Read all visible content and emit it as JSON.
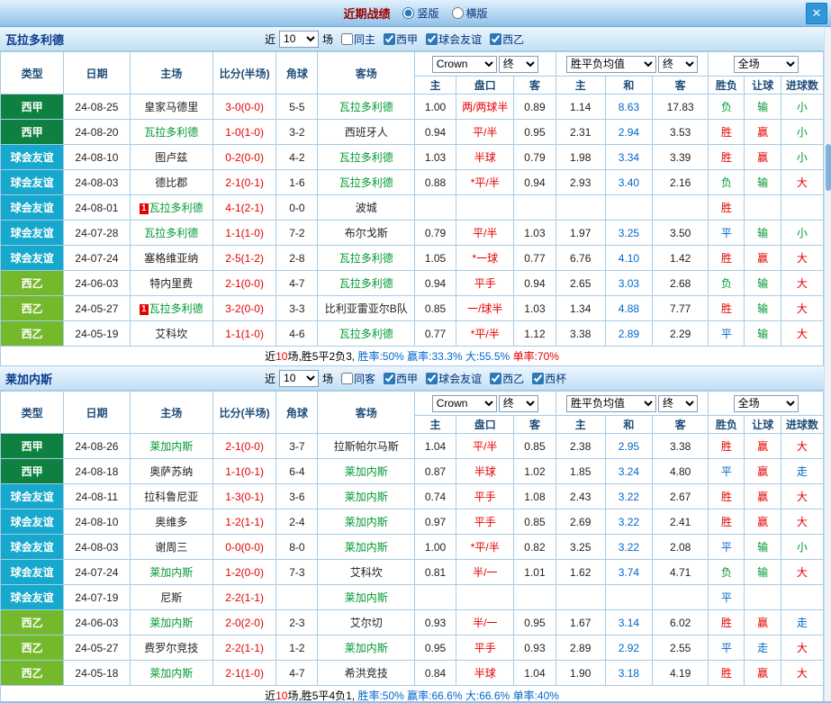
{
  "titlebar": {
    "title": "近期战绩",
    "radios": [
      {
        "label": "竖版",
        "selected": true
      },
      {
        "label": "横版",
        "selected": false
      }
    ],
    "close_glyph": "✕"
  },
  "league_colors": {
    "西甲": "#0e8040",
    "球会友谊": "#17a8cd",
    "西乙": "#74b82c"
  },
  "header": {
    "cols": [
      "类型",
      "日期",
      "主场",
      "比分(半场)",
      "角球",
      "客场"
    ],
    "odds_company": "Crown",
    "final_label": "终",
    "avg_label": "胜平负均值",
    "full_label": "全场",
    "odds_sub": [
      "主",
      "盘口",
      "客"
    ],
    "avg_sub": [
      "主",
      "和",
      "客"
    ],
    "result_sub": [
      "胜负",
      "让球",
      "进球数"
    ]
  },
  "sections": [
    {
      "team": "瓦拉多利德",
      "filter": {
        "prefix": "近",
        "count": "10",
        "suffix": "场",
        "venue_label": "同主",
        "venue_checked": false,
        "leagues": [
          {
            "label": "西甲",
            "checked": true
          },
          {
            "label": "球会友谊",
            "checked": true
          },
          {
            "label": "西乙",
            "checked": true
          }
        ]
      },
      "rows": [
        {
          "league": "西甲",
          "date": "24-08-25",
          "home": "皇家马德里",
          "home_green": false,
          "home_badge": "",
          "score": "3-0(0-0)",
          "corners": "5-5",
          "away": "瓦拉多利德",
          "away_green": true,
          "odds_home": "1.00",
          "handicap": "两/两球半",
          "odds_away": "0.89",
          "avg_home": "1.14",
          "avg_draw": "8.63",
          "avg_away": "17.83",
          "result": "负",
          "result_type": "lose",
          "handicap_result": "输",
          "handicap_type": "lose",
          "goals": "小",
          "goals_type": "lose"
        },
        {
          "league": "西甲",
          "date": "24-08-20",
          "home": "瓦拉多利德",
          "home_green": true,
          "home_badge": "",
          "score": "1-0(1-0)",
          "corners": "3-2",
          "away": "西班牙人",
          "away_green": false,
          "odds_home": "0.94",
          "handicap": "平/半",
          "odds_away": "0.95",
          "avg_home": "2.31",
          "avg_draw": "2.94",
          "avg_away": "3.53",
          "result": "胜",
          "result_type": "win",
          "handicap_result": "赢",
          "handicap_type": "win",
          "goals": "小",
          "goals_type": "lose"
        },
        {
          "league": "球会友谊",
          "date": "24-08-10",
          "home": "图卢兹",
          "home_green": false,
          "home_badge": "",
          "score": "0-2(0-0)",
          "corners": "4-2",
          "away": "瓦拉多利德",
          "away_green": true,
          "odds_home": "1.03",
          "handicap": "半球",
          "odds_away": "0.79",
          "avg_home": "1.98",
          "avg_draw": "3.34",
          "avg_away": "3.39",
          "result": "胜",
          "result_type": "win",
          "handicap_result": "赢",
          "handicap_type": "win",
          "goals": "小",
          "goals_type": "lose"
        },
        {
          "league": "球会友谊",
          "date": "24-08-03",
          "home": "德比郡",
          "home_green": false,
          "home_badge": "",
          "score": "2-1(0-1)",
          "corners": "1-6",
          "away": "瓦拉多利德",
          "away_green": true,
          "odds_home": "0.88",
          "handicap": "*平/半",
          "odds_away": "0.94",
          "avg_home": "2.93",
          "avg_draw": "3.40",
          "avg_away": "2.16",
          "result": "负",
          "result_type": "lose",
          "handicap_result": "输",
          "handicap_type": "lose",
          "goals": "大",
          "goals_type": "win"
        },
        {
          "league": "球会友谊",
          "date": "24-08-01",
          "home": "瓦拉多利德",
          "home_green": true,
          "home_badge": "1",
          "score": "4-1(2-1)",
          "corners": "0-0",
          "away": "波城",
          "away_green": false,
          "odds_home": "",
          "handicap": "",
          "odds_away": "",
          "avg_home": "",
          "avg_draw": "",
          "avg_away": "",
          "result": "胜",
          "result_type": "win",
          "handicap_result": "",
          "handicap_type": "",
          "goals": "",
          "goals_type": ""
        },
        {
          "league": "球会友谊",
          "date": "24-07-28",
          "home": "瓦拉多利德",
          "home_green": true,
          "home_badge": "",
          "score": "1-1(1-0)",
          "corners": "7-2",
          "away": "布尔戈斯",
          "away_green": false,
          "odds_home": "0.79",
          "handicap": "平/半",
          "odds_away": "1.03",
          "avg_home": "1.97",
          "avg_draw": "3.25",
          "avg_away": "3.50",
          "result": "平",
          "result_type": "draw",
          "handicap_result": "输",
          "handicap_type": "lose",
          "goals": "小",
          "goals_type": "lose"
        },
        {
          "league": "球会友谊",
          "date": "24-07-24",
          "home": "塞格维亚纳",
          "home_green": false,
          "home_badge": "",
          "score": "2-5(1-2)",
          "corners": "2-8",
          "away": "瓦拉多利德",
          "away_green": true,
          "odds_home": "1.05",
          "handicap": "*一球",
          "odds_away": "0.77",
          "avg_home": "6.76",
          "avg_draw": "4.10",
          "avg_away": "1.42",
          "result": "胜",
          "result_type": "win",
          "handicap_result": "赢",
          "handicap_type": "win",
          "goals": "大",
          "goals_type": "win"
        },
        {
          "league": "西乙",
          "date": "24-06-03",
          "home": "特内里费",
          "home_green": false,
          "home_badge": "",
          "score": "2-1(0-0)",
          "corners": "4-7",
          "away": "瓦拉多利德",
          "away_green": true,
          "odds_home": "0.94",
          "handicap": "平手",
          "odds_away": "0.94",
          "avg_home": "2.65",
          "avg_draw": "3.03",
          "avg_away": "2.68",
          "result": "负",
          "result_type": "lose",
          "handicap_result": "输",
          "handicap_type": "lose",
          "goals": "大",
          "goals_type": "win"
        },
        {
          "league": "西乙",
          "date": "24-05-27",
          "home": "瓦拉多利德",
          "home_green": true,
          "home_badge": "1",
          "score": "3-2(0-0)",
          "corners": "3-3",
          "away": "比利亚雷亚尔B队",
          "away_green": false,
          "odds_home": "0.85",
          "handicap": "一/球半",
          "odds_away": "1.03",
          "avg_home": "1.34",
          "avg_draw": "4.88",
          "avg_away": "7.77",
          "result": "胜",
          "result_type": "win",
          "handicap_result": "输",
          "handicap_type": "lose",
          "goals": "大",
          "goals_type": "win"
        },
        {
          "league": "西乙",
          "date": "24-05-19",
          "home": "艾科坎",
          "home_green": false,
          "home_badge": "",
          "score": "1-1(1-0)",
          "corners": "4-6",
          "away": "瓦拉多利德",
          "away_green": true,
          "odds_home": "0.77",
          "handicap": "*平/半",
          "odds_away": "1.12",
          "avg_home": "3.38",
          "avg_draw": "2.89",
          "avg_away": "2.29",
          "result": "平",
          "result_type": "draw",
          "handicap_result": "输",
          "handicap_type": "lose",
          "goals": "大",
          "goals_type": "win"
        }
      ],
      "footer_parts": [
        {
          "text": "近",
          "color": "#000000"
        },
        {
          "text": "10",
          "color": "#e60000"
        },
        {
          "text": "场,胜5平2负3, ",
          "color": "#000000"
        },
        {
          "text": "胜率:50%",
          "color": "#0066cc"
        },
        {
          "text": " 赢率:33.3%",
          "color": "#0066cc"
        },
        {
          "text": " 大:55.5%",
          "color": "#0066cc"
        },
        {
          "text": " 单率:70%",
          "color": "#e60000"
        }
      ]
    },
    {
      "team": "莱加内斯",
      "filter": {
        "prefix": "近",
        "count": "10",
        "suffix": "场",
        "venue_label": "同客",
        "venue_checked": false,
        "leagues": [
          {
            "label": "西甲",
            "checked": true
          },
          {
            "label": "球会友谊",
            "checked": true
          },
          {
            "label": "西乙",
            "checked": true
          },
          {
            "label": "西杯",
            "checked": true
          }
        ]
      },
      "rows": [
        {
          "league": "西甲",
          "date": "24-08-26",
          "home": "莱加内斯",
          "home_green": true,
          "home_badge": "",
          "score": "2-1(0-0)",
          "corners": "3-7",
          "away": "拉斯帕尔马斯",
          "away_green": false,
          "odds_home": "1.04",
          "handicap": "平/半",
          "odds_away": "0.85",
          "avg_home": "2.38",
          "avg_draw": "2.95",
          "avg_away": "3.38",
          "result": "胜",
          "result_type": "win",
          "handicap_result": "赢",
          "handicap_type": "win",
          "goals": "大",
          "goals_type": "win"
        },
        {
          "league": "西甲",
          "date": "24-08-18",
          "home": "奥萨苏纳",
          "home_green": false,
          "home_badge": "",
          "score": "1-1(0-1)",
          "corners": "6-4",
          "away": "莱加内斯",
          "away_green": true,
          "odds_home": "0.87",
          "handicap": "半球",
          "odds_away": "1.02",
          "avg_home": "1.85",
          "avg_draw": "3.24",
          "avg_away": "4.80",
          "result": "平",
          "result_type": "draw",
          "handicap_result": "赢",
          "handicap_type": "win",
          "goals": "走",
          "goals_type": "draw"
        },
        {
          "league": "球会友谊",
          "date": "24-08-11",
          "home": "拉科鲁尼亚",
          "home_green": false,
          "home_badge": "",
          "score": "1-3(0-1)",
          "corners": "3-6",
          "away": "莱加内斯",
          "away_green": true,
          "odds_home": "0.74",
          "handicap": "平手",
          "odds_away": "1.08",
          "avg_home": "2.43",
          "avg_draw": "3.22",
          "avg_away": "2.67",
          "result": "胜",
          "result_type": "win",
          "handicap_result": "赢",
          "handicap_type": "win",
          "goals": "大",
          "goals_type": "win"
        },
        {
          "league": "球会友谊",
          "date": "24-08-10",
          "home": "奥维多",
          "home_green": false,
          "home_badge": "",
          "score": "1-2(1-1)",
          "corners": "2-4",
          "away": "莱加内斯",
          "away_green": true,
          "odds_home": "0.97",
          "handicap": "平手",
          "odds_away": "0.85",
          "avg_home": "2.69",
          "avg_draw": "3.22",
          "avg_away": "2.41",
          "result": "胜",
          "result_type": "win",
          "handicap_result": "赢",
          "handicap_type": "win",
          "goals": "大",
          "goals_type": "win"
        },
        {
          "league": "球会友谊",
          "date": "24-08-03",
          "home": "谢周三",
          "home_green": false,
          "home_badge": "",
          "score": "0-0(0-0)",
          "corners": "8-0",
          "away": "莱加内斯",
          "away_green": true,
          "odds_home": "1.00",
          "handicap": "*平/半",
          "odds_away": "0.82",
          "avg_home": "3.25",
          "avg_draw": "3.22",
          "avg_away": "2.08",
          "result": "平",
          "result_type": "draw",
          "handicap_result": "输",
          "handicap_type": "lose",
          "goals": "小",
          "goals_type": "lose"
        },
        {
          "league": "球会友谊",
          "date": "24-07-24",
          "home": "莱加内斯",
          "home_green": true,
          "home_badge": "",
          "score": "1-2(0-0)",
          "corners": "7-3",
          "away": "艾科坎",
          "away_green": false,
          "odds_home": "0.81",
          "handicap": "半/一",
          "odds_away": "1.01",
          "avg_home": "1.62",
          "avg_draw": "3.74",
          "avg_away": "4.71",
          "result": "负",
          "result_type": "lose",
          "handicap_result": "输",
          "handicap_type": "lose",
          "goals": "大",
          "goals_type": "win"
        },
        {
          "league": "球会友谊",
          "date": "24-07-19",
          "home": "尼斯",
          "home_green": false,
          "home_badge": "",
          "score": "2-2(1-1)",
          "corners": "",
          "away": "莱加内斯",
          "away_green": true,
          "odds_home": "",
          "handicap": "",
          "odds_away": "",
          "avg_home": "",
          "avg_draw": "",
          "avg_away": "",
          "result": "平",
          "result_type": "draw",
          "handicap_result": "",
          "handicap_type": "",
          "goals": "",
          "goals_type": ""
        },
        {
          "league": "西乙",
          "date": "24-06-03",
          "home": "莱加内斯",
          "home_green": true,
          "home_badge": "",
          "score": "2-0(2-0)",
          "corners": "2-3",
          "away": "艾尔切",
          "away_green": false,
          "odds_home": "0.93",
          "handicap": "半/一",
          "odds_away": "0.95",
          "avg_home": "1.67",
          "avg_draw": "3.14",
          "avg_away": "6.02",
          "result": "胜",
          "result_type": "win",
          "handicap_result": "赢",
          "handicap_type": "win",
          "goals": "走",
          "goals_type": "draw"
        },
        {
          "league": "西乙",
          "date": "24-05-27",
          "home": "费罗尔竞技",
          "home_green": false,
          "home_badge": "",
          "score": "2-2(1-1)",
          "corners": "1-2",
          "away": "莱加内斯",
          "away_green": true,
          "odds_home": "0.95",
          "handicap": "平手",
          "odds_away": "0.93",
          "avg_home": "2.89",
          "avg_draw": "2.92",
          "avg_away": "2.55",
          "result": "平",
          "result_type": "draw",
          "handicap_result": "走",
          "handicap_type": "draw",
          "goals": "大",
          "goals_type": "win"
        },
        {
          "league": "西乙",
          "date": "24-05-18",
          "home": "莱加内斯",
          "home_green": true,
          "home_badge": "",
          "score": "2-1(1-0)",
          "corners": "4-7",
          "away": "希洪竞技",
          "away_green": false,
          "odds_home": "0.84",
          "handicap": "半球",
          "odds_away": "1.04",
          "avg_home": "1.90",
          "avg_draw": "3.18",
          "avg_away": "4.19",
          "result": "胜",
          "result_type": "win",
          "handicap_result": "赢",
          "handicap_type": "win",
          "goals": "大",
          "goals_type": "win"
        }
      ],
      "footer_parts": [
        {
          "text": "近",
          "color": "#000000"
        },
        {
          "text": "10",
          "color": "#e60000"
        },
        {
          "text": "场,胜5平4负1, ",
          "color": "#000000"
        },
        {
          "text": "胜率:50%",
          "color": "#0066cc"
        },
        {
          "text": " 赢率:66.6%",
          "color": "#0066cc"
        },
        {
          "text": " 大:66.6%",
          "color": "#0066cc"
        },
        {
          "text": " 单率:40%",
          "color": "#0066cc"
        }
      ]
    }
  ]
}
